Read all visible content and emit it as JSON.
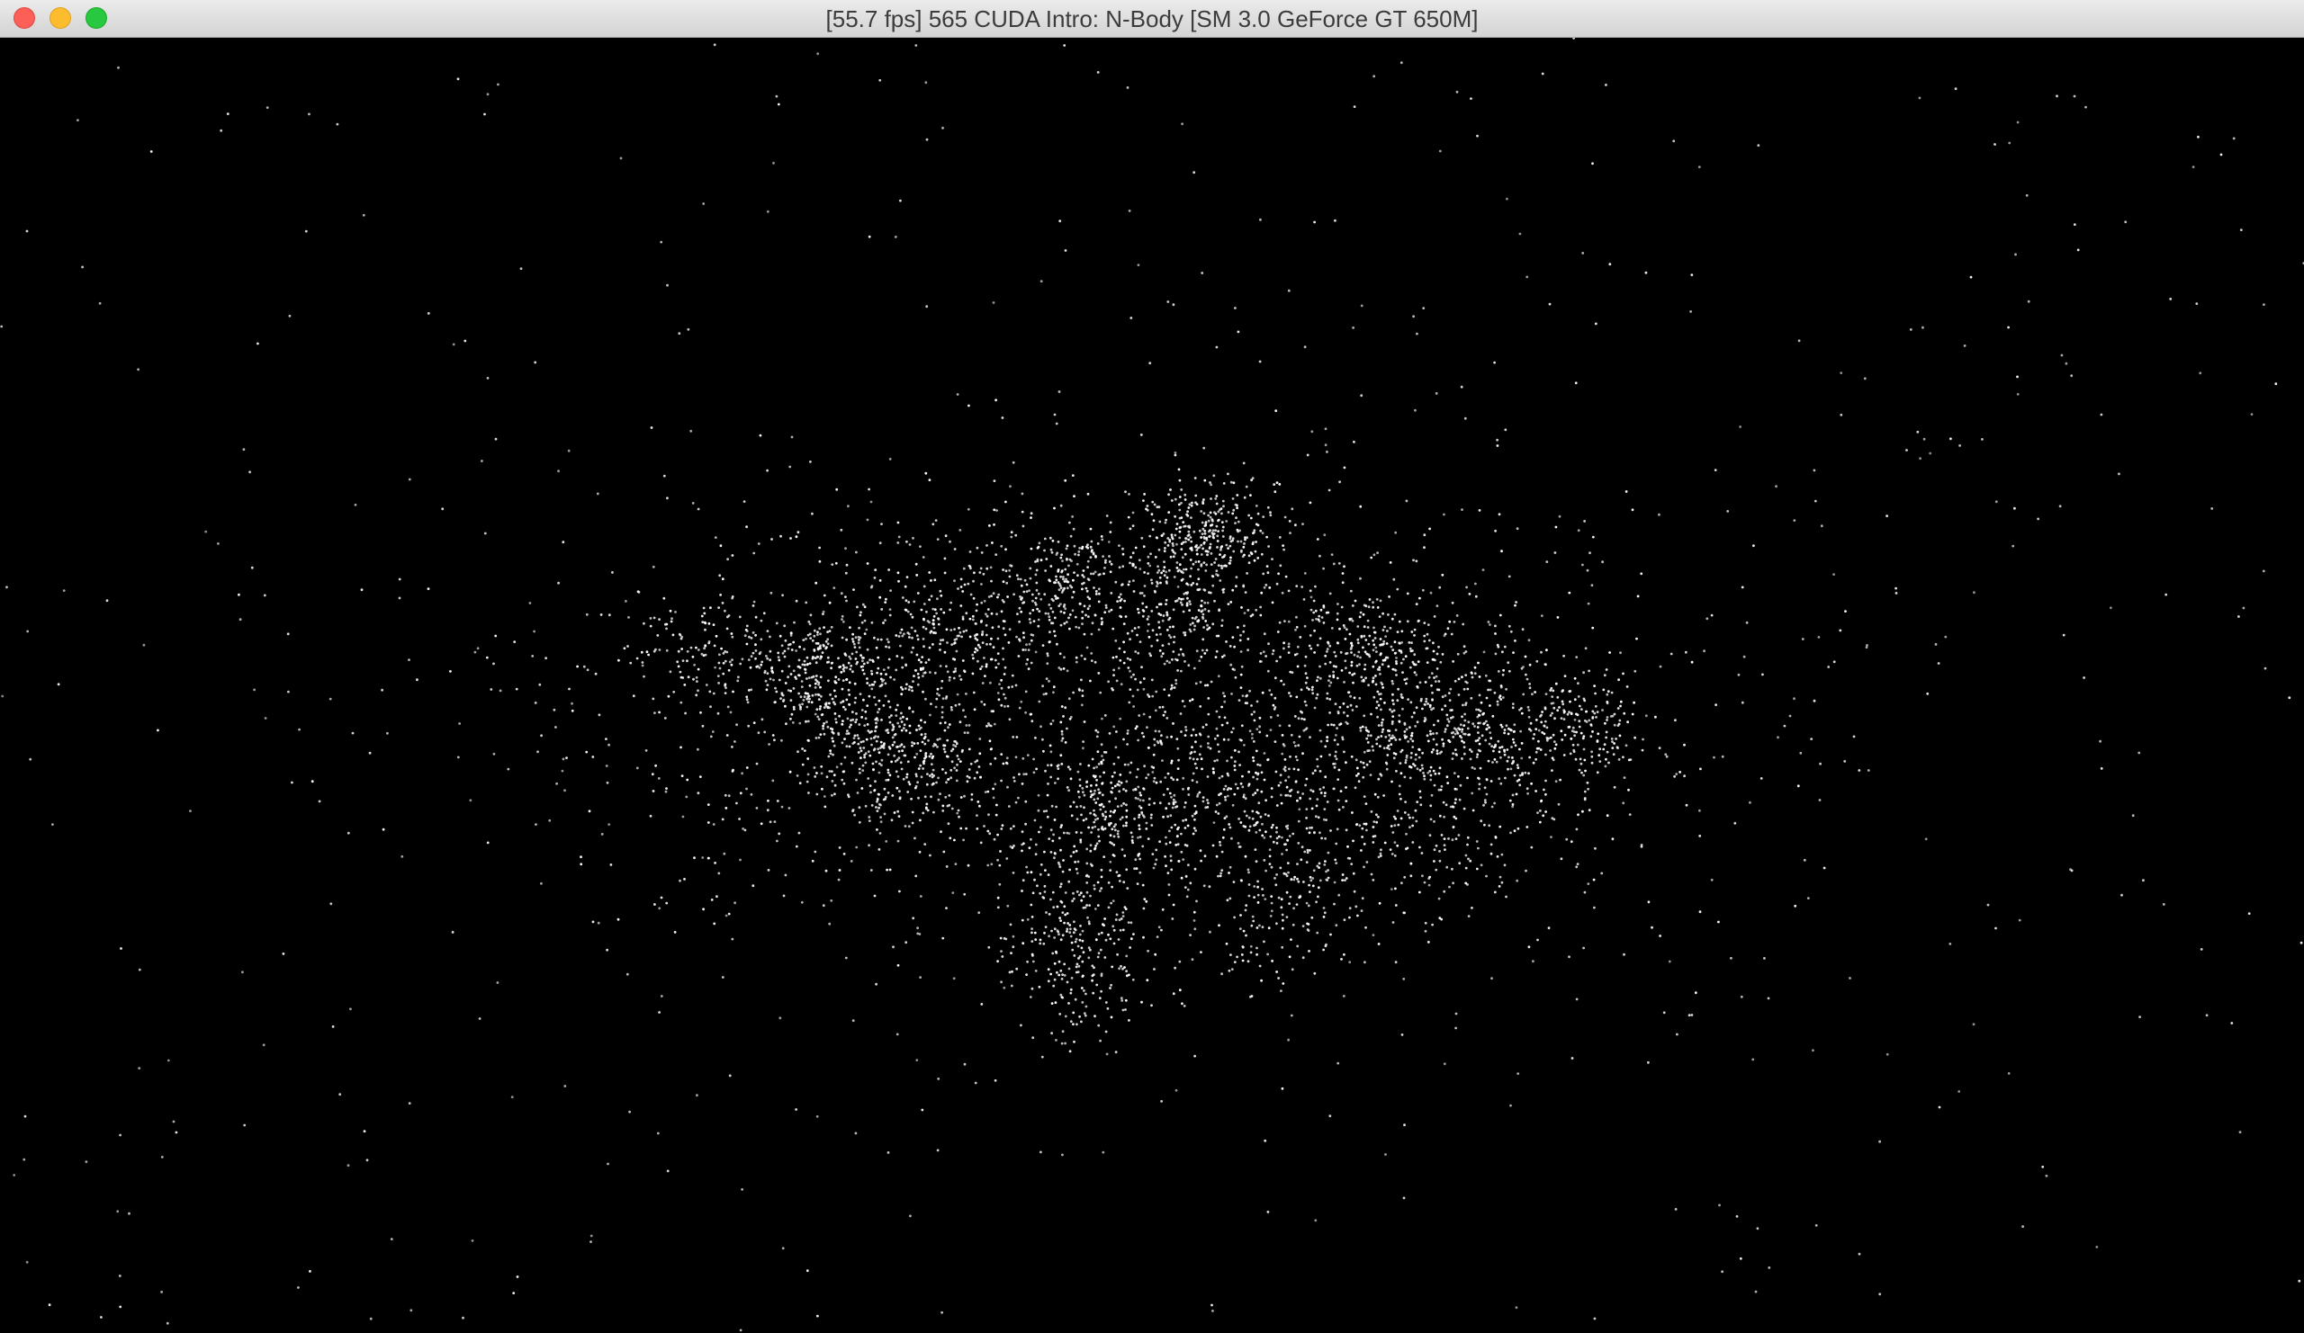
{
  "window": {
    "title": "[55.7 fps] 565 CUDA Intro: N-Body [SM 3.0 GeForce GT 650M]"
  },
  "colors": {
    "background": "#000000",
    "particle": "#ffffff",
    "titlebar": "#d9d9d9",
    "close": "#fc5f57",
    "minimize": "#fdbc2e",
    "zoom": "#28c840"
  },
  "icons": [
    "close-icon",
    "minimize-icon",
    "zoom-icon"
  ]
}
